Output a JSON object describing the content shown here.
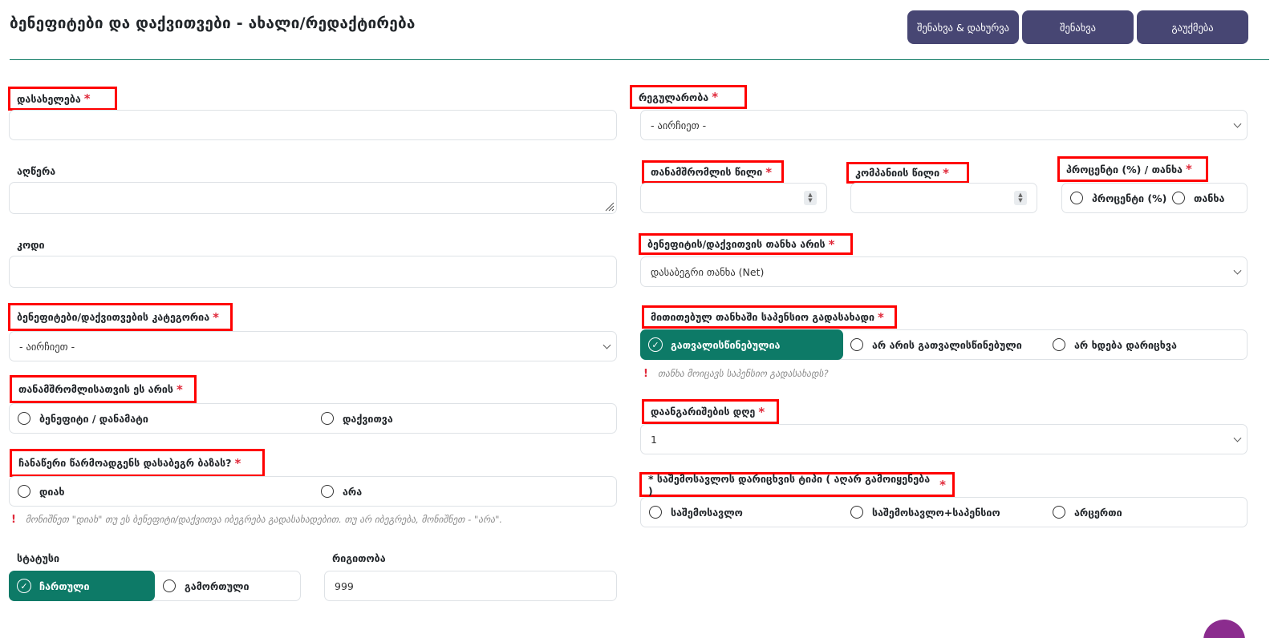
{
  "header": {
    "title": "ბენეფიტები და დაქვითვები - ახალი/რედაქტირება",
    "buttons": {
      "save_close": "შენახვა & დახურვა",
      "save": "შენახვა",
      "cancel": "გაუქმება"
    }
  },
  "required_mark": "*",
  "left": {
    "name": {
      "label": "დასახელება",
      "value": ""
    },
    "description": {
      "label": "აღწერა",
      "value": ""
    },
    "code": {
      "label": "კოდი",
      "value": ""
    },
    "category": {
      "label": "ბენეფიტები/დაქვითვების კატეგორია",
      "selected": "- აირჩიეთ -"
    },
    "employee_type": {
      "label": "თანამშრომლისათვის ეს არის",
      "options": [
        "ბენეფიტი / დანამატი",
        "დაქვითვა"
      ]
    },
    "taxable_base": {
      "label": "ჩანაწერი წარმოადგენს დასაბეგრ ბაზას?",
      "options": [
        "დიახ",
        "არა"
      ],
      "note": "მონიშნეთ \"დიახ\" თუ ეს ბენეფიტი/დაქვითვა იბეგრება გადასახადებით. თუ არ იბეგრება, მონიშნეთ - \"არა\"."
    },
    "status": {
      "label": "სტატუსი",
      "options": [
        "ჩართული",
        "გამორთული"
      ],
      "selected_index": 0
    },
    "order": {
      "label": "რიგითობა",
      "value": "999"
    }
  },
  "right": {
    "regularity": {
      "label": "რეგულარობა",
      "selected": "- აირჩიეთ -"
    },
    "employee_share": {
      "label": "თანამშრომლის წილი",
      "value": ""
    },
    "company_share": {
      "label": "კომპანიის წილი",
      "value": ""
    },
    "percent_amount": {
      "label": "პროცენტი (%) / თანხა",
      "options": [
        "პროცენტი (%)",
        "თანხა"
      ]
    },
    "amount_type": {
      "label": "ბენეფიტის/დაქვითვის თანხა არის",
      "selected": "დასაბეგრი თანხა (Net)"
    },
    "pension_included": {
      "label": "მითითებულ თანხაში საპენსიო გადასახადი",
      "options": [
        "გათვალისწინებულია",
        "არ არის გათვალისწინებული",
        "არ ხდება დარიცხვა"
      ],
      "selected_index": 0,
      "note": "თანხა მოიცავს საპენსიო გადასახადს?"
    },
    "calc_day": {
      "label": "დაანგარიშების დღე",
      "selected": "1"
    },
    "income_type": {
      "label": "* საშემოსავლოს დარიცხვის ტიპი ( აღარ გამოიყენება )",
      "options": [
        "საშემოსავლო",
        "საშემოსავლო+საპენსიო",
        "არცერთი"
      ]
    }
  },
  "colors": {
    "primary_button": "#474673",
    "selected_green": "#0d7a67",
    "required_red": "#e0293a",
    "highlight_box": "#ff0000"
  }
}
